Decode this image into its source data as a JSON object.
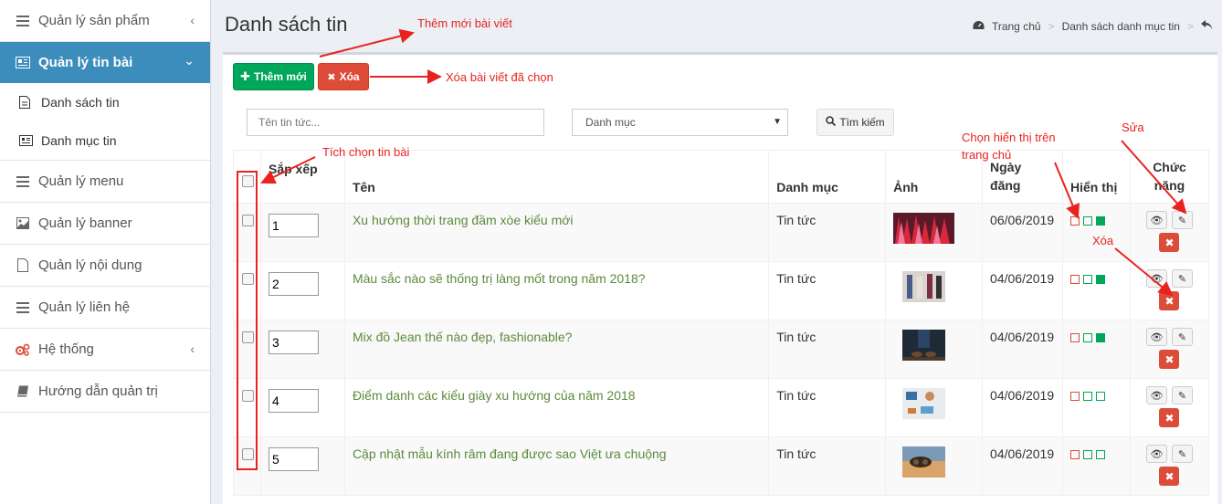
{
  "sidebar": {
    "items": [
      {
        "label": "Quản lý sản phẩm",
        "icon": "bars-icon",
        "chevron": "‹"
      },
      {
        "label": "Quản lý tin bài",
        "icon": "newspaper-icon",
        "chevron": "⌄",
        "active": true
      },
      {
        "label": "Quản lý menu",
        "icon": "bars-icon"
      },
      {
        "label": "Quản lý banner",
        "icon": "image-icon"
      },
      {
        "label": "Quản lý nội dung",
        "icon": "file-icon"
      },
      {
        "label": "Quản lý liên hệ",
        "icon": "bars-icon"
      },
      {
        "label": "Hệ thống",
        "icon": "cogs-icon",
        "chevron": "‹"
      },
      {
        "label": "Hướng dẫn quản trị",
        "icon": "book-icon"
      }
    ],
    "subitems": [
      {
        "label": "Danh sách tin",
        "icon": "file-icon"
      },
      {
        "label": "Danh mục tin",
        "icon": "newspaper-icon"
      }
    ]
  },
  "header": {
    "title": "Danh sách tin",
    "breadcrumb": [
      "Trang chủ",
      "Danh sách danh mục tin"
    ]
  },
  "toolbar": {
    "add_label": "Thêm mới",
    "delete_label": "Xóa",
    "search_placeholder": "Tên tin tức...",
    "category_selected": "Danh mục",
    "search_label": "Tìm kiếm"
  },
  "table": {
    "headers": {
      "order": "Sắp xếp",
      "name": "Tên",
      "category": "Danh mục",
      "image": "Ảnh",
      "date": "Ngày đăng",
      "display": "Hiển thị",
      "actions": "Chức năng"
    },
    "rows": [
      {
        "order": "1",
        "title": "Xu hướng thời trang đầm xòe kiểu mới",
        "category": "Tin tức",
        "date": "06/06/2019",
        "flags": [
          false,
          false,
          true
        ]
      },
      {
        "order": "2",
        "title": "Màu sắc nào sẽ thống trị làng mốt trong năm 2018?",
        "category": "Tin tức",
        "date": "04/06/2019",
        "flags": [
          false,
          false,
          true
        ]
      },
      {
        "order": "3",
        "title": "Mix đồ Jean thế nào đẹp, fashionable?",
        "category": "Tin tức",
        "date": "04/06/2019",
        "flags": [
          false,
          false,
          true
        ]
      },
      {
        "order": "4",
        "title": "Điểm danh các kiểu giày xu hướng của năm 2018",
        "category": "Tin tức",
        "date": "04/06/2019",
        "flags": [
          false,
          false,
          false
        ]
      },
      {
        "order": "5",
        "title": "Cập nhật mẫu kính râm đang được sao Việt ưa chuộng",
        "category": "Tin tức",
        "date": "04/06/2019",
        "flags": [
          false,
          false,
          false
        ]
      }
    ]
  },
  "annotations": {
    "add": "Thêm mới bài viết",
    "delete": "Xóa bài viết đã chọn",
    "check": "Tích chọn tin bài",
    "display": "Chọn hiển thị trên trang chủ",
    "edit": "Sửa",
    "remove": "Xóa"
  },
  "colors": {
    "accent": "#3c8dbc",
    "success": "#00a65a",
    "danger": "#dd4b39",
    "annotation": "#e8231e",
    "link": "#5b8a3a"
  }
}
